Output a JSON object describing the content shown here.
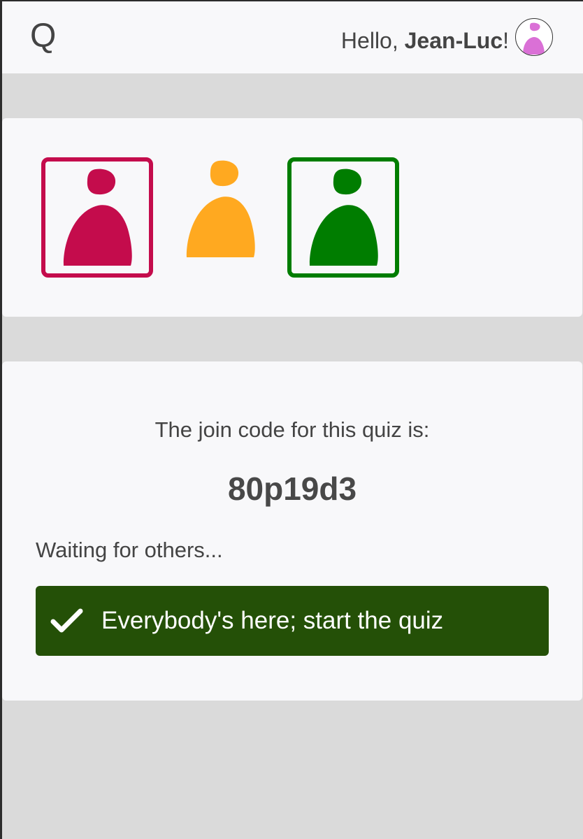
{
  "header": {
    "logo": "Q",
    "greeting_prefix": "Hello, ",
    "user_name": "Jean-Luc",
    "greeting_suffix": "!",
    "avatar_color": "#da70d6"
  },
  "players": [
    {
      "icon": "person-icon",
      "color": "#c40c4c",
      "ready": true
    },
    {
      "icon": "person-icon",
      "color": "#ffa920",
      "ready": false
    },
    {
      "icon": "person-icon",
      "color": "#007d00",
      "ready": true
    }
  ],
  "quiz": {
    "join_code_label": "The join code for this quiz is:",
    "join_code": "80p19d3",
    "waiting_text": "Waiting for others...",
    "start_button_label": "Everybody's here; start the quiz",
    "start_button_icon": "checkmark-icon",
    "start_button_color": "#245007"
  }
}
